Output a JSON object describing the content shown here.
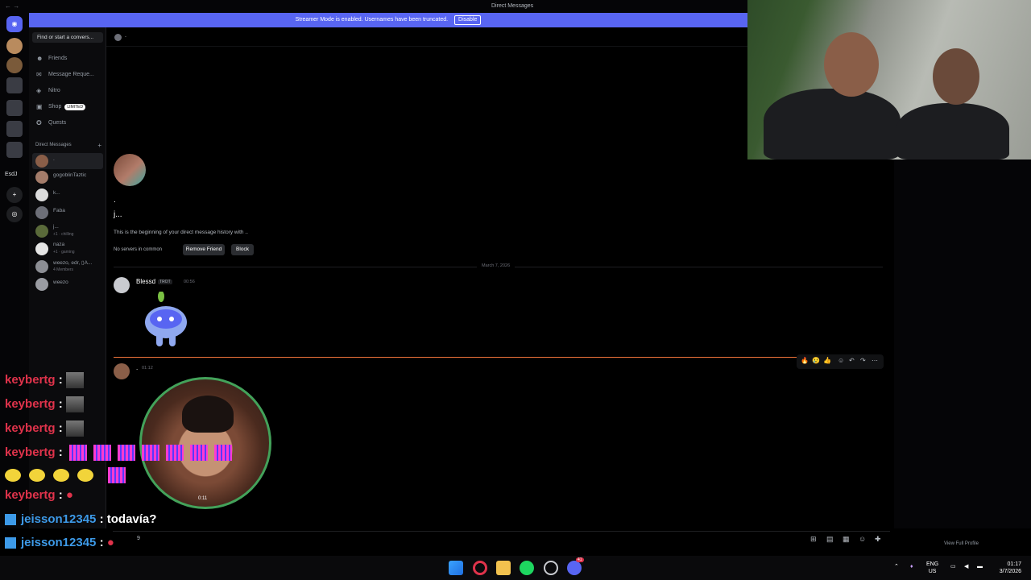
{
  "window": {
    "title": "Direct Messages",
    "nav_arrows": "← →"
  },
  "banner": {
    "text": "Streamer Mode is enabled. Usernames have been truncated.",
    "disable_label": "Disable",
    "color": "#5865f2"
  },
  "guild_rail": {
    "label_esdj": "EsdJ"
  },
  "dm_sidebar": {
    "search_placeholder": "Find or start a convers...",
    "nav": [
      {
        "label": "Friends",
        "icon": "friends-icon"
      },
      {
        "label": "Message Reque...",
        "icon": "mail-icon"
      },
      {
        "label": "Nitro",
        "icon": "nitro-icon"
      },
      {
        "label": "Shop",
        "icon": "shop-icon",
        "badge": "LIMITED"
      },
      {
        "label": "Quests",
        "icon": "quests-icon"
      }
    ],
    "header": "Direct Messages",
    "dms": [
      {
        "name": ".",
        "sub": ""
      },
      {
        "name": "gogoblinTaztic",
        "sub": ""
      },
      {
        "name": "k...",
        "sub": ""
      },
      {
        "name": "Faba",
        "sub": ""
      },
      {
        "name": "j...",
        "sub": "+1 · chilling"
      },
      {
        "name": "naza",
        "sub": "+1 · gaming"
      },
      {
        "name": "weezo, edr, ▯A...",
        "sub": "4 Members"
      },
      {
        "name": "weezo",
        "sub": ""
      }
    ]
  },
  "channel": {
    "header_name": ".",
    "dot": ".",
    "username": "j...",
    "beginning": "This is the beginning of your direct message history with ..",
    "no_servers": "No servers in common",
    "remove_friend": "Remove Friend",
    "block": "Block",
    "date_divider": "March 7, 2026",
    "messages": [
      {
        "author": "Blessd",
        "tag": "TROT",
        "time": "00:56"
      },
      {
        "author": ".",
        "time": "01:12",
        "video_time": "0:11"
      }
    ],
    "reactions": [
      "🔥",
      "😢",
      "👍",
      "☺",
      "↶",
      "↷",
      "⋯"
    ]
  },
  "right_panel": {
    "view_full_profile": "View Full Profile"
  },
  "stream_chat": [
    {
      "user": "keybertg",
      "sep": ":"
    },
    {
      "user": "keybertg",
      "sep": ":"
    },
    {
      "user": "keybertg",
      "sep": ":"
    },
    {
      "user": "keybertg",
      "sep": ":"
    },
    {
      "user": "keybertg",
      "sep": ":"
    },
    {
      "user": "jeisson12345",
      "sep": ":",
      "text": "todavía?"
    },
    {
      "user": "jeisson12345",
      "sep": ":",
      "text": ""
    },
    {
      "user": "jeisson12345",
      "sep": ":",
      "text": ""
    }
  ],
  "composer": {
    "count": "9"
  },
  "taskbar": {
    "lang_top": "ENG",
    "lang_bottom": "US",
    "time": "01:17",
    "date": "3/7/2026",
    "discord_badge": "41"
  }
}
